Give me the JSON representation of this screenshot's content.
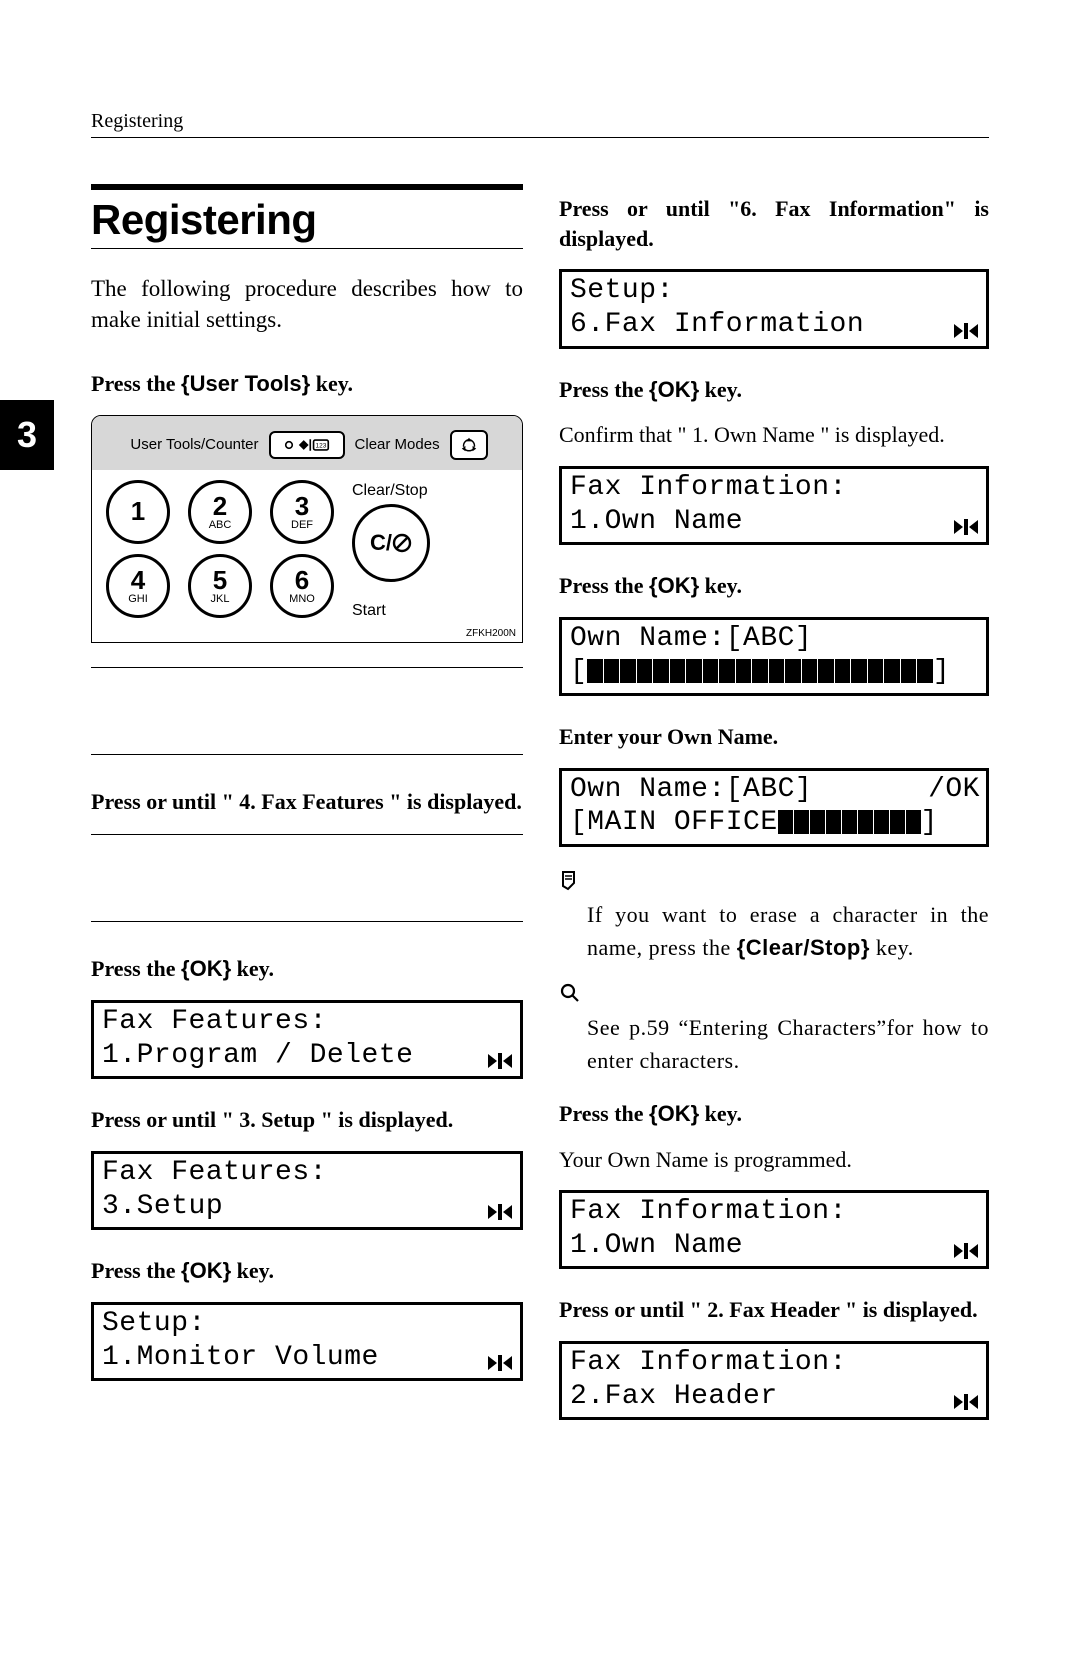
{
  "header": {
    "running": "Registering"
  },
  "tab": {
    "label": "3"
  },
  "title": "Registering",
  "intro": "The following procedure describes how to make initial settings.",
  "left": {
    "step1": {
      "pre": "Press the ",
      "key": "{User Tools}",
      "post": " key."
    },
    "panel": {
      "top": {
        "label_left": "User Tools/Counter",
        "label_right": "Clear Modes"
      },
      "keys": [
        {
          "num": "1",
          "sub": ""
        },
        {
          "num": "2",
          "sub": "ABC"
        },
        {
          "num": "3",
          "sub": "DEF"
        },
        {
          "num": "4",
          "sub": "GHI"
        },
        {
          "num": "5",
          "sub": "JKL"
        },
        {
          "num": "6",
          "sub": "MNO"
        }
      ],
      "right": {
        "clearstop": "Clear/Stop",
        "c_label": "C/",
        "start": "Start"
      },
      "ref": "ZFKH200N"
    },
    "step3": "Press   or   until \" 4. Fax Features \" is displayed.",
    "step4": {
      "pre": "Press the ",
      "key": "{OK}",
      "post": " key."
    },
    "lcd1": {
      "l1": "Fax Features:",
      "l2": "1.Program / Delete"
    },
    "step5": "Press   or   until \" 3. Setup \" is displayed.",
    "lcd2": {
      "l1": "Fax Features:",
      "l2": "3.Setup"
    },
    "step6": {
      "pre": "Press the ",
      "key": "{OK}",
      "post": " key."
    },
    "lcd3": {
      "l1": "Setup:",
      "l2": "1.Monitor Volume"
    }
  },
  "right": {
    "step7": "Press   or   until \"6. Fax Information\" is displayed.",
    "lcd4": {
      "l1": "Setup:",
      "l2": "6.Fax Information"
    },
    "step8": {
      "pre": "Press the ",
      "key": "{OK}",
      "post": " key."
    },
    "note8": "Confirm that \" 1. Own Name \" is displayed.",
    "lcd5": {
      "l1": "Fax Information:",
      "l2": "1.Own Name"
    },
    "step9": {
      "pre": "Press the ",
      "key": "{OK}",
      "post": " key."
    },
    "lcd6": {
      "l1": "Own Name:[ABC]",
      "l2_prefix": "[",
      "l2_suffix": "]"
    },
    "step10": "Enter your Own Name.",
    "lcd7": {
      "l1": "Own Name:[ABC]",
      "ok": "/OK",
      "l2_prefix": "[MAIN OFFICE",
      "l2_suffix": "]"
    },
    "memo1a": "If you want to erase a character in the name, press the ",
    "memo1b": "{Clear/Stop}",
    "memo1c": " key.",
    "ref1": "See p.59 “Entering Characters”for how to enter characters.",
    "step11": {
      "pre": "Press the ",
      "key": "{OK}",
      "post": " key."
    },
    "note11": "Your Own Name is programmed.",
    "lcd8": {
      "l1": "Fax Information:",
      "l2": "1.Own Name"
    },
    "step12": "Press   or   until \" 2. Fax Header \" is displayed.",
    "lcd9": {
      "l1": "Fax Information:",
      "l2": "2.Fax Header"
    }
  }
}
